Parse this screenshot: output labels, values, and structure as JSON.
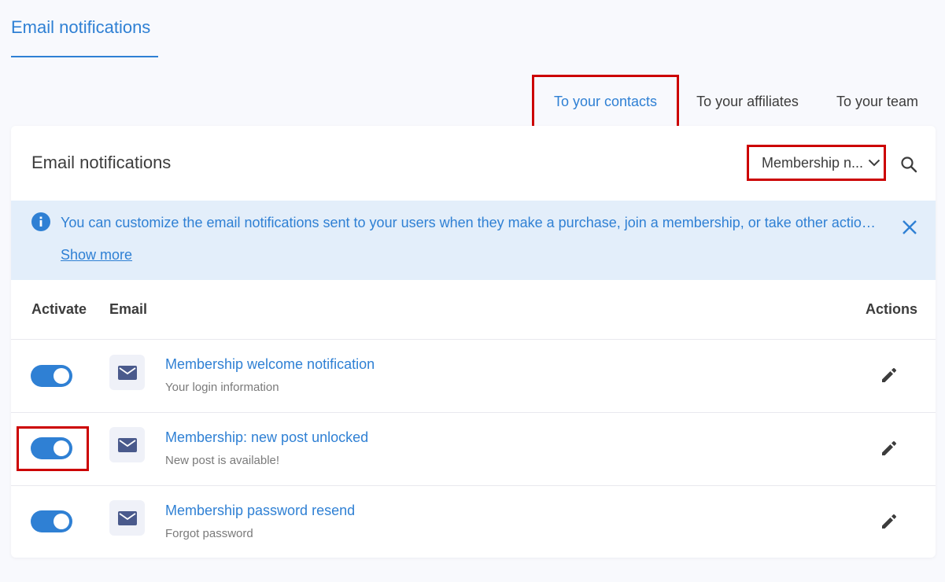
{
  "page_tab": {
    "label": "Email notifications"
  },
  "subtabs": [
    {
      "label": "To your contacts",
      "active": true
    },
    {
      "label": "To your affiliates",
      "active": false
    },
    {
      "label": "To your team",
      "active": false
    }
  ],
  "card": {
    "title": "Email notifications",
    "filter": {
      "selected": "Membership n..."
    },
    "search_icon": "search-icon"
  },
  "info_banner": {
    "text": "You can customize the email notifications sent to your users when they make a purchase, join a membership, or take other actions. T...",
    "show_more": "Show more"
  },
  "table": {
    "headers": {
      "activate": "Activate",
      "email": "Email",
      "actions": "Actions"
    },
    "rows": [
      {
        "name": "Membership welcome notification",
        "subject": "Your login information",
        "active": true
      },
      {
        "name": "Membership: new post unlocked",
        "subject": "New post is available!",
        "active": true
      },
      {
        "name": "Membership password resend",
        "subject": "Forgot password",
        "active": true
      }
    ]
  },
  "colors": {
    "accent": "#2f80d4",
    "banner_bg": "#e3eefa",
    "highlight": "#cc0000",
    "mail_icon": "#4a5a8c"
  }
}
